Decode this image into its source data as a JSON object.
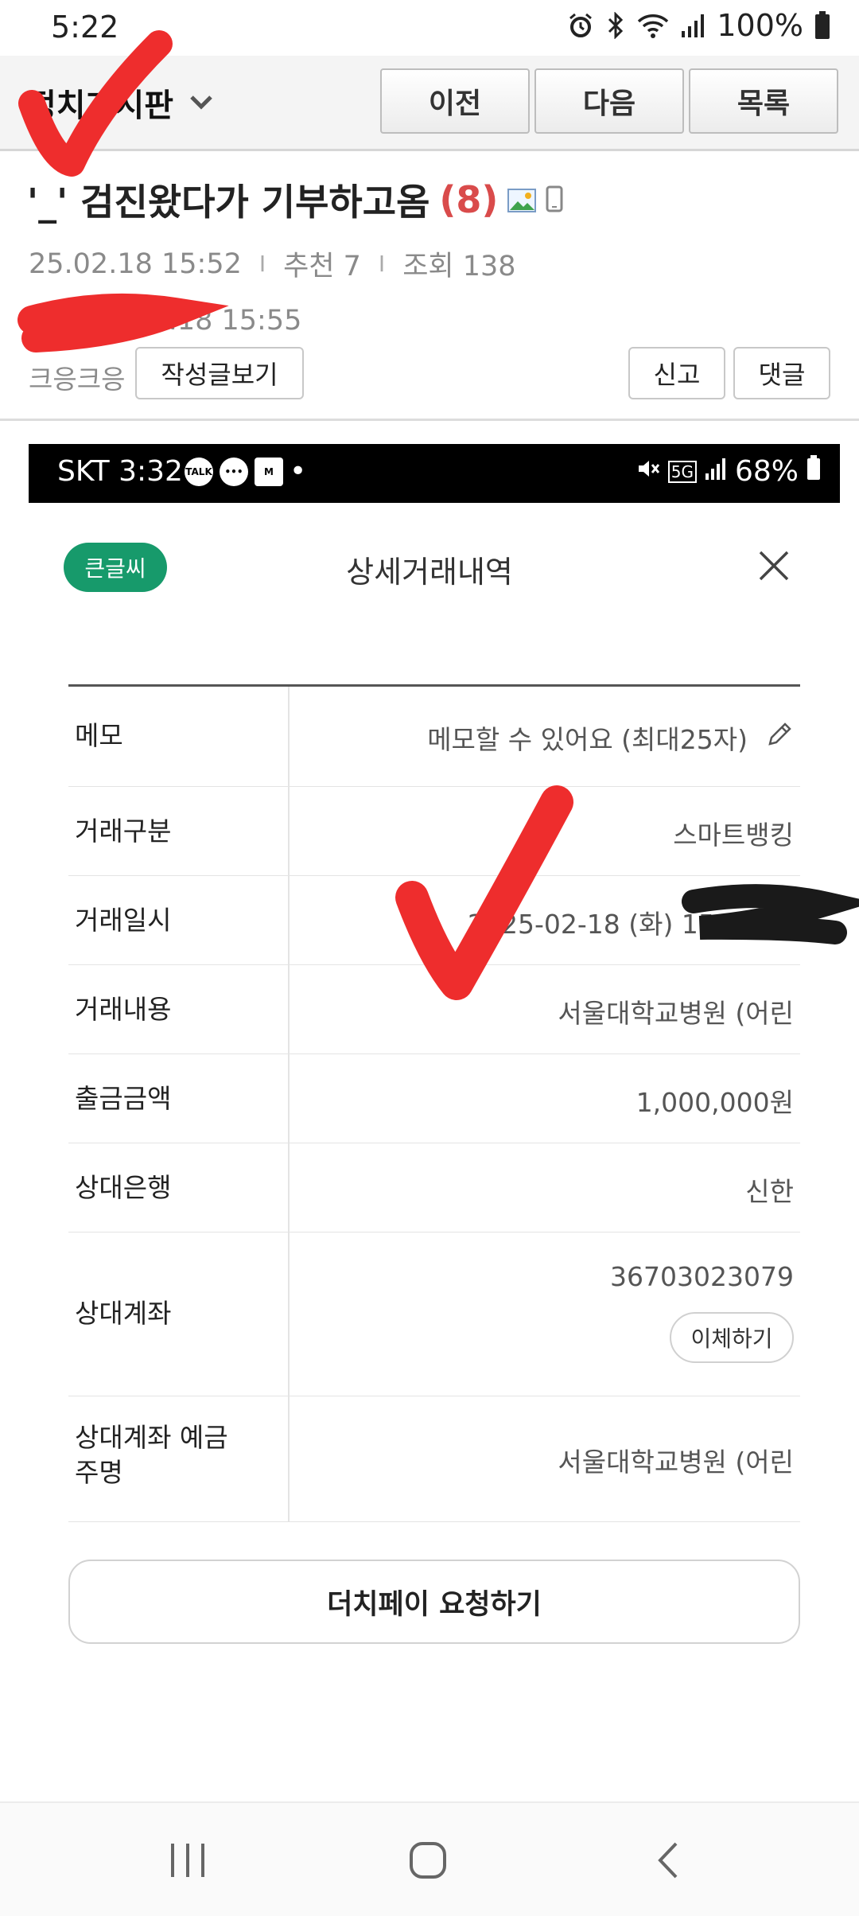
{
  "status_bar": {
    "time": "5:22",
    "battery": "100%",
    "icons": [
      "alarm-icon",
      "bluetooth-icon",
      "wifi-icon",
      "signal-icon",
      "battery-icon"
    ]
  },
  "board": {
    "name": "정치게시판",
    "prev_label": "이전",
    "next_label": "다음",
    "list_label": "목록"
  },
  "post": {
    "title": "'_' 검진왔다가 기부하고옴",
    "comment_count": "(8)",
    "date": "25.02.18  15:52",
    "recommend": "추천 7",
    "views": "조회 138",
    "modified": "수정 25.02.18  15:55",
    "author": "크응크응",
    "author_posts_label": "작성글보기",
    "report_label": "신고",
    "comment_label": "댓글"
  },
  "screenshot": {
    "status_bar": {
      "carrier_time": "SKT 3:32",
      "icons": [
        "kakaotalk-icon",
        "chat-icon",
        "mstock-icon"
      ],
      "battery": "68%",
      "network": "5G"
    },
    "big_text_label": "큰글씨",
    "sheet_title": "상세거래내역",
    "rows": [
      {
        "label": "메모",
        "value": "메모할 수 있어요 (최대25자)"
      },
      {
        "label": "거래구분",
        "value": "스마트뱅킹"
      },
      {
        "label": "거래일시",
        "value": "2025-02-18 (화) 15:"
      },
      {
        "label": "거래내용",
        "value": "서울대학교병원 (어린"
      },
      {
        "label": "출금금액",
        "value": "1,000,000원"
      },
      {
        "label": "상대은행",
        "value": "신한"
      },
      {
        "label": "상대계좌",
        "value": "36703023079"
      },
      {
        "label": "상대계좌 예금주명",
        "value": "서울대학교병원 (어린"
      }
    ],
    "transfer_label": "이체하기",
    "dutch_pay_label": "더치페이 요청하기"
  },
  "colors": {
    "accent_red": "#d94b4b",
    "green_pill": "#179a6b",
    "markup_red": "#ee2d2d"
  }
}
